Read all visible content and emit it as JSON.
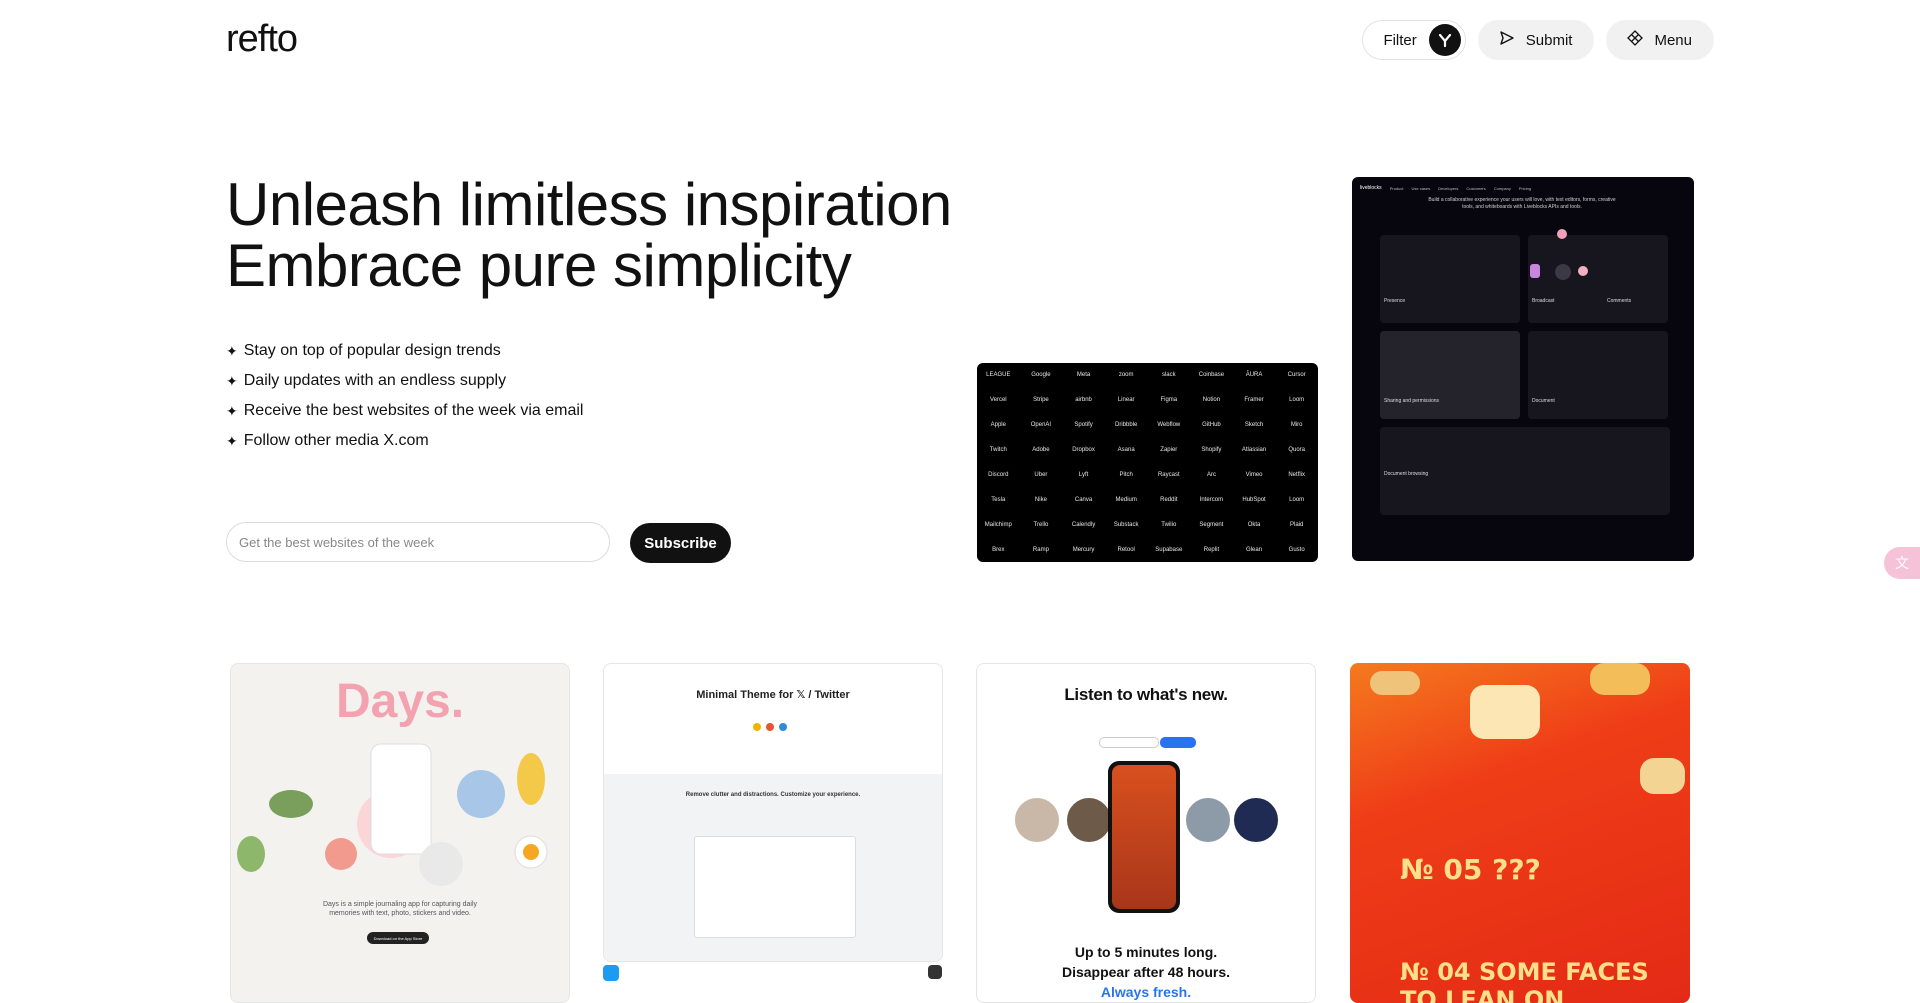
{
  "header": {
    "logo": "refto",
    "filter_label": "Filter",
    "submit_label": "Submit",
    "menu_label": "Menu"
  },
  "hero": {
    "title_line1": "Unleash limitless inspiration",
    "title_line2": "Embrace pure simplicity",
    "features": [
      "Stay on top of popular design trends",
      "Daily updates with an endless supply",
      "Receive the best websites of the week via email",
      "Follow other media X.com"
    ],
    "email_placeholder": "Get the best websites of the week",
    "subscribe_label": "Subscribe"
  },
  "logo_wall": [
    "LEAGUE",
    "Google",
    "Meta",
    "zoom",
    "slack",
    "Coinbase",
    "ĀURA",
    "Cursor",
    "Vercel",
    "Stripe",
    "airbnb",
    "Linear",
    "Figma",
    "Notion",
    "Framer",
    "Loom",
    "Apple",
    "OpenAI",
    "Spotify",
    "Dribbble",
    "Webflow",
    "GitHub",
    "Sketch",
    "Miro",
    "Twitch",
    "Adobe",
    "Dropbox",
    "Asana",
    "Zapier",
    "Shopify",
    "Atlassian",
    "Quora",
    "Discord",
    "Uber",
    "Lyft",
    "Pitch",
    "Raycast",
    "Arc",
    "Vimeo",
    "Netflix",
    "Tesla",
    "Nike",
    "Canva",
    "Medium",
    "Reddit",
    "Intercom",
    "HubSpot",
    "Loom",
    "Mailchimp",
    "Trello",
    "Calendly",
    "Substack",
    "Twilio",
    "Segment",
    "Okta",
    "Plaid",
    "Brex",
    "Ramp",
    "Mercury",
    "Retool",
    "Supabase",
    "Replit",
    "Glean",
    "Gusto"
  ],
  "dark_card": {
    "brand": "liveblocks",
    "nav": [
      "Product",
      "Use cases",
      "Developers",
      "Customers",
      "Company",
      "Pricing"
    ],
    "hero_text": "Build a collaborative experience your users will love, with text editors, forms, creative tools, and whiteboards with Liveblocks APIs and tools.",
    "labels": [
      "Presence",
      "Broadcast",
      "Comments",
      "Sharing and permissions",
      "Document",
      "Document browsing"
    ]
  },
  "gallery": {
    "days": {
      "title": "Days.",
      "subtitle": "Days is a simple journaling app for capturing daily memories with text, photo, stickers and video.",
      "button": "Download on the App Store"
    },
    "twitter": {
      "title": "Minimal Theme for 𝕏 / Twitter",
      "subtitle": "Remove clutter and distractions. Customize your experience."
    },
    "listen": {
      "title": "Listen to what's new.",
      "footer1": "Up to 5 minutes long.",
      "footer2": "Disappear after 48 hours.",
      "footer3": "Always fresh."
    },
    "faces": {
      "line1": "№ 05 ???",
      "line2": "№ 04 SOME FACES TO LEAN ON"
    }
  },
  "colors": {
    "accent_dark": "#111111",
    "days_pink": "#f3a3b0",
    "listen_blue": "#2a73f0",
    "faces_red": "#e32a16"
  }
}
